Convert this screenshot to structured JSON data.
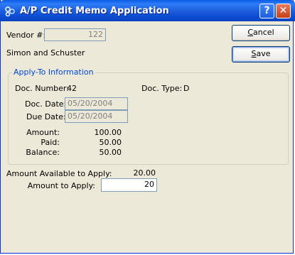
{
  "window": {
    "title": "A/P Credit Memo Application"
  },
  "titlebar": {
    "help_glyph": "?",
    "close_glyph": "✕"
  },
  "vendor": {
    "label": "Vendor #:",
    "number": "122",
    "name": "Simon and Schuster"
  },
  "buttons": {
    "cancel": {
      "mnemonic": "C",
      "rest": "ancel"
    },
    "save": {
      "mnemonic": "S",
      "rest": "ave"
    }
  },
  "apply_to": {
    "group_title": "Apply-To Information",
    "doc_number_label": "Doc. Number:",
    "doc_number": "42",
    "doc_type_label": "Doc. Type:",
    "doc_type": "D",
    "doc_date_label": "Doc. Date:",
    "doc_date": "05/20/2004",
    "due_date_label": "Due Date:",
    "due_date": "05/20/2004",
    "amount_label": "Amount:",
    "amount": "100.00",
    "paid_label": "Paid:",
    "paid": "50.00",
    "balance_label": "Balance:",
    "balance": "50.00"
  },
  "application": {
    "available_label": "Amount Available to Apply:",
    "available": "20.00",
    "to_apply_label": "Amount to Apply:",
    "to_apply": "20"
  }
}
